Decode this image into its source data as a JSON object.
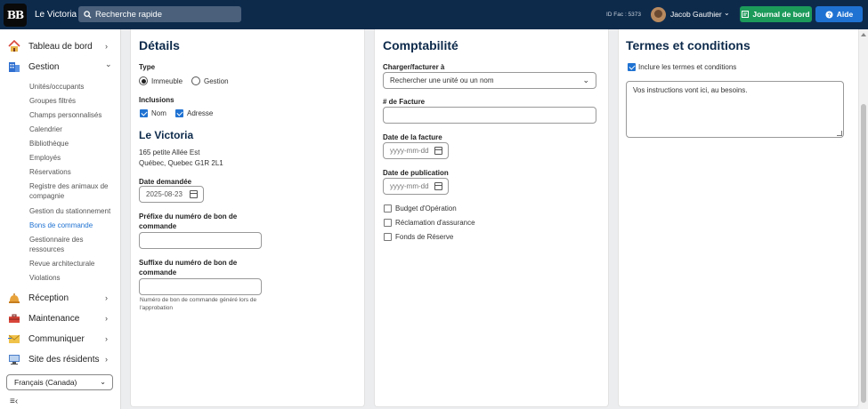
{
  "header": {
    "logo_text": "BB",
    "app_title": "Le Victoria",
    "search_placeholder": "Recherche rapide",
    "id_fac": "ID Fac : 5373",
    "user_name": "Jacob Gauthier",
    "journal_label": "Journal de bord",
    "aide_label": "Aide"
  },
  "sidebar": {
    "top_items": [
      {
        "label": "Tableau de bord",
        "chev": "›"
      },
      {
        "label": "Gestion",
        "chev": "⌄"
      }
    ],
    "sub_items": [
      "Unités/occupants",
      "Groupes filtrés",
      "Champs personnalisés",
      "Calendrier",
      "Bibliothèque",
      "Employés",
      "Réservations",
      "Registre des animaux de compagnie",
      "Gestion du stationnement",
      "Bons de commande",
      "Gestionnaire des ressources",
      "Revue architecturale",
      "Violations"
    ],
    "bottom_items": [
      {
        "label": "Réception",
        "chev": "›"
      },
      {
        "label": "Maintenance",
        "chev": "›"
      },
      {
        "label": "Communiquer",
        "chev": "›"
      },
      {
        "label": "Site des résidents",
        "chev": "›"
      }
    ],
    "language": "Français (Canada)"
  },
  "details": {
    "title": "Détails",
    "type_label": "Type",
    "type_options": [
      "Immeuble",
      "Gestion"
    ],
    "inclusions_label": "Inclusions",
    "inclusion_options": [
      "Nom",
      "Adresse"
    ],
    "building_name": "Le Victoria",
    "address_line1": "165 petite Allée Est",
    "address_line2": "Québec, Quebec G1R 2L1",
    "date_label": "Date demandée",
    "date_value": "2025-08-23",
    "prefix_label": "Préfixe du numéro de bon de commande",
    "suffix_label": "Suffixe du numéro de bon de commande",
    "hint": "Numéro de bon de commande généré lors de l'approbation"
  },
  "comptabilite": {
    "title": "Comptabilité",
    "charge_label": "Charger/facturer à",
    "charge_placeholder": "Rechercher une unité ou un nom",
    "invoice_label": "# de Facture",
    "invoice_date_label": "Date de la facture",
    "publication_date_label": "Date de publication",
    "date_placeholder": "yyyy-mm-dd",
    "checkboxes": [
      "Budget d'Opération",
      "Réclamation d'assurance",
      "Fonds de Réserve"
    ]
  },
  "terms": {
    "title": "Termes et conditions",
    "include_label": "Inclure les termes et conditions",
    "text": "Vos instructions vont ici, au besoins."
  }
}
